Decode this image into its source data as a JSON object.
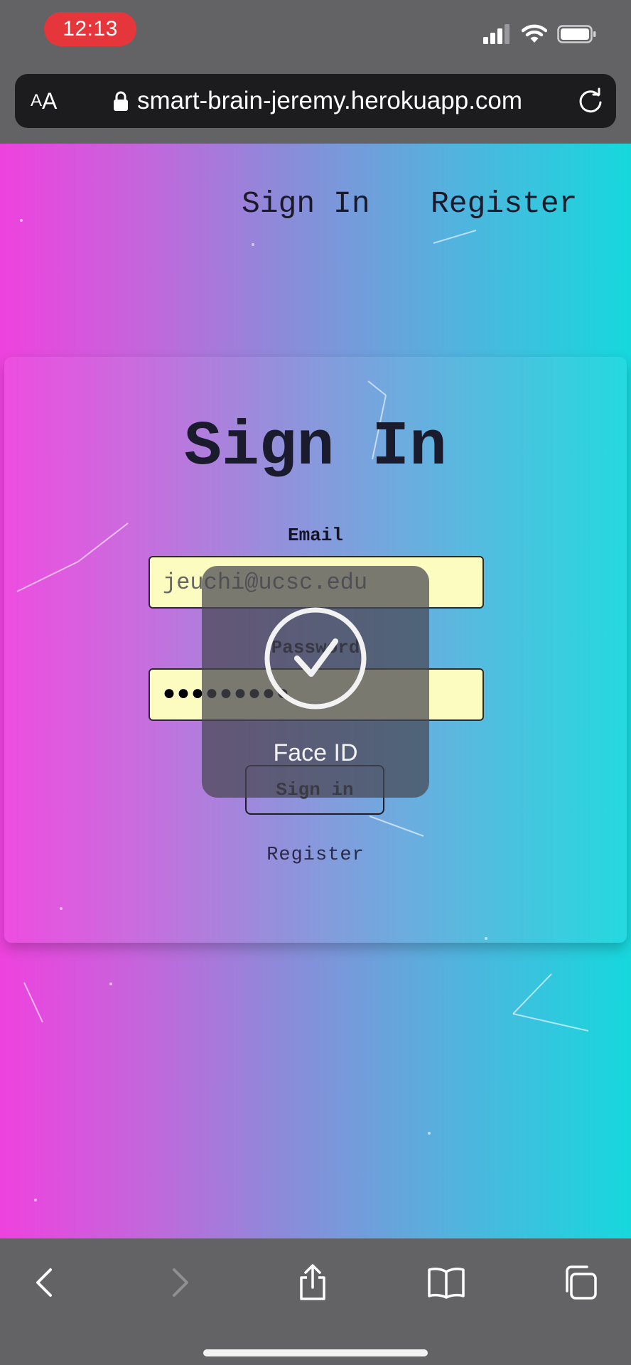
{
  "status_bar": {
    "time": "12:13",
    "icons": [
      "cellular-signal-icon",
      "wifi-icon",
      "battery-icon"
    ]
  },
  "browser": {
    "text_size_label_small": "A",
    "text_size_label_big": "A",
    "url": "smart-brain-jeremy.herokuapp.com",
    "lock_icon": "lock-icon",
    "reload_icon": "reload-icon"
  },
  "nav": {
    "sign_in": "Sign In",
    "register": "Register"
  },
  "form": {
    "title": "Sign In",
    "email_label": "Email",
    "email_value": "jeuchi@ucsc.edu",
    "password_label": "Password",
    "password_value": "●●●●●●●●●",
    "submit_label": "Sign in",
    "register_link": "Register"
  },
  "face_id": {
    "label": "Face ID",
    "icon": "checkmark-circle-icon"
  },
  "toolbar": {
    "icons": [
      "back-icon",
      "forward-icon",
      "share-icon",
      "bookmarks-icon",
      "tabs-icon"
    ]
  },
  "colors": {
    "gradient_left": "#ee42de",
    "gradient_right": "#16d8dd",
    "input_background": "#fcfcc0",
    "time_pill": "#e5363b"
  }
}
